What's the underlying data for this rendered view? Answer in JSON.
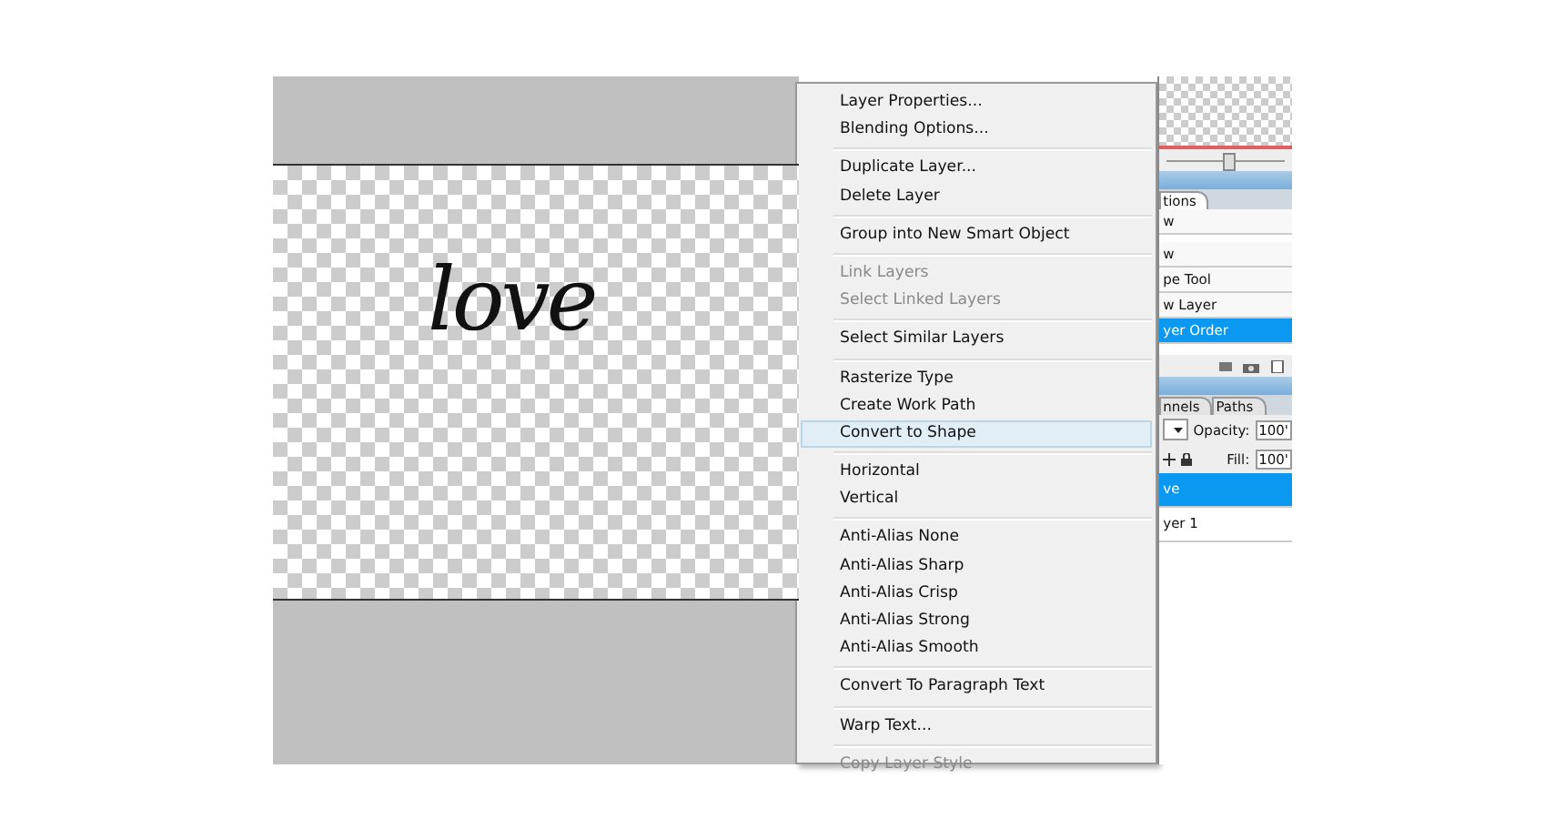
{
  "canvas": {
    "text": "love"
  },
  "navigator": {
    "zoom_slider": {
      "level": 0.52
    }
  },
  "context_menu": {
    "groups": [
      [
        {
          "label": "Layer Properties...",
          "disabled": false,
          "selected": false
        },
        {
          "label": "Blending Options...",
          "disabled": false,
          "selected": false
        }
      ],
      [
        {
          "label": "Duplicate Layer...",
          "disabled": false,
          "selected": false
        },
        {
          "label": "Delete Layer",
          "disabled": false,
          "selected": false
        }
      ],
      [
        {
          "label": "Group into New Smart Object",
          "disabled": false,
          "selected": false
        }
      ],
      [
        {
          "label": "Link Layers",
          "disabled": true,
          "selected": false
        },
        {
          "label": "Select Linked Layers",
          "disabled": true,
          "selected": false
        }
      ],
      [
        {
          "label": "Select Similar Layers",
          "disabled": false,
          "selected": false
        }
      ],
      [
        {
          "label": "Rasterize Type",
          "disabled": false,
          "selected": false
        },
        {
          "label": "Create Work Path",
          "disabled": false,
          "selected": false
        },
        {
          "label": "Convert to Shape",
          "disabled": false,
          "selected": true
        }
      ],
      [
        {
          "label": "Horizontal",
          "disabled": false,
          "selected": false
        },
        {
          "label": "Vertical",
          "disabled": false,
          "selected": false
        }
      ],
      [
        {
          "label": "Anti-Alias None",
          "disabled": false,
          "selected": false
        },
        {
          "label": "Anti-Alias Sharp",
          "disabled": false,
          "selected": false
        },
        {
          "label": "Anti-Alias Crisp",
          "disabled": false,
          "selected": false
        },
        {
          "label": "Anti-Alias Strong",
          "disabled": false,
          "selected": false
        },
        {
          "label": "Anti-Alias Smooth",
          "disabled": false,
          "selected": false
        }
      ],
      [
        {
          "label": "Convert To Paragraph Text",
          "disabled": false,
          "selected": false
        }
      ],
      [
        {
          "label": "Warp Text...",
          "disabled": false,
          "selected": false
        }
      ],
      [
        {
          "label": "Copy Layer Style",
          "disabled": true,
          "selected": false
        }
      ]
    ]
  },
  "actions_panel": {
    "tab": "tions",
    "items": [
      {
        "label": "w",
        "selected": false
      },
      {
        "label": "w",
        "selected": false
      },
      {
        "label": "pe Tool",
        "selected": false
      },
      {
        "label": "w Layer",
        "selected": false
      },
      {
        "label": "yer Order",
        "selected": true
      }
    ]
  },
  "layers_panel": {
    "tabs": [
      {
        "label": "nnels",
        "selected": false
      },
      {
        "label": "Paths",
        "selected": false
      }
    ],
    "opacity_label": "Opacity:",
    "opacity_value": "100'",
    "fill_label": "Fill:",
    "fill_value": "100'",
    "layers": [
      {
        "name": "ve",
        "selected": true
      },
      {
        "name": "yer 1",
        "selected": false
      }
    ]
  }
}
